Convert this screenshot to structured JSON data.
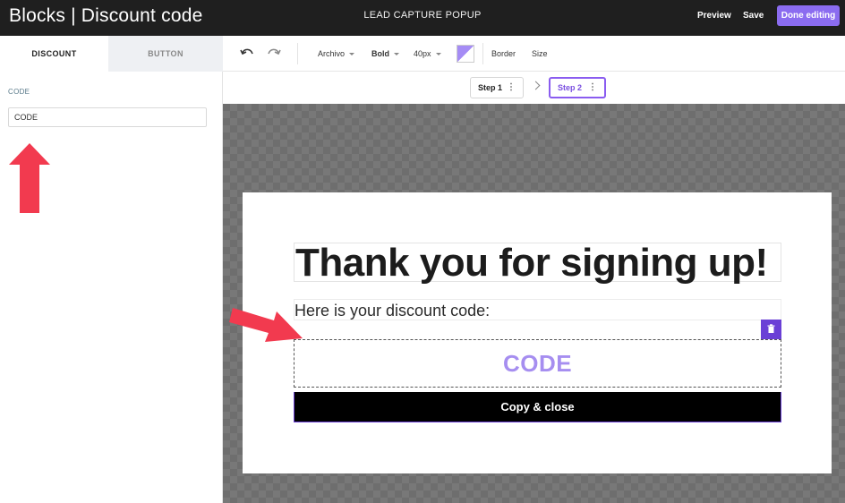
{
  "topbar": {
    "app_title": "Blocks | Discount code",
    "center_title": "LEAD CAPTURE POPUP",
    "preview_label": "Preview",
    "save_label": "Save",
    "done_label": "Done editing"
  },
  "left_panel": {
    "tabs": [
      {
        "label": "DISCOUNT",
        "active": true
      },
      {
        "label": "BUTTON",
        "active": false
      }
    ],
    "field_label": "CODE",
    "field_value": "CODE"
  },
  "toolbar": {
    "font_family": "Archivo",
    "font_weight": "Bold",
    "font_size": "40px",
    "color": "#a58cf5",
    "border_label": "Border",
    "size_label": "Size"
  },
  "steps": [
    {
      "label": "Step 1",
      "active": false
    },
    {
      "label": "Step 2",
      "active": true
    }
  ],
  "popup": {
    "headline": "Thank you for signing up!",
    "subtext": "Here is your discount code:",
    "code": "CODE",
    "button_label": "Copy & close"
  },
  "colors": {
    "accent": "#8b6cf0",
    "code_text": "#a68ef0",
    "annotation_arrow": "#f23a4f"
  }
}
